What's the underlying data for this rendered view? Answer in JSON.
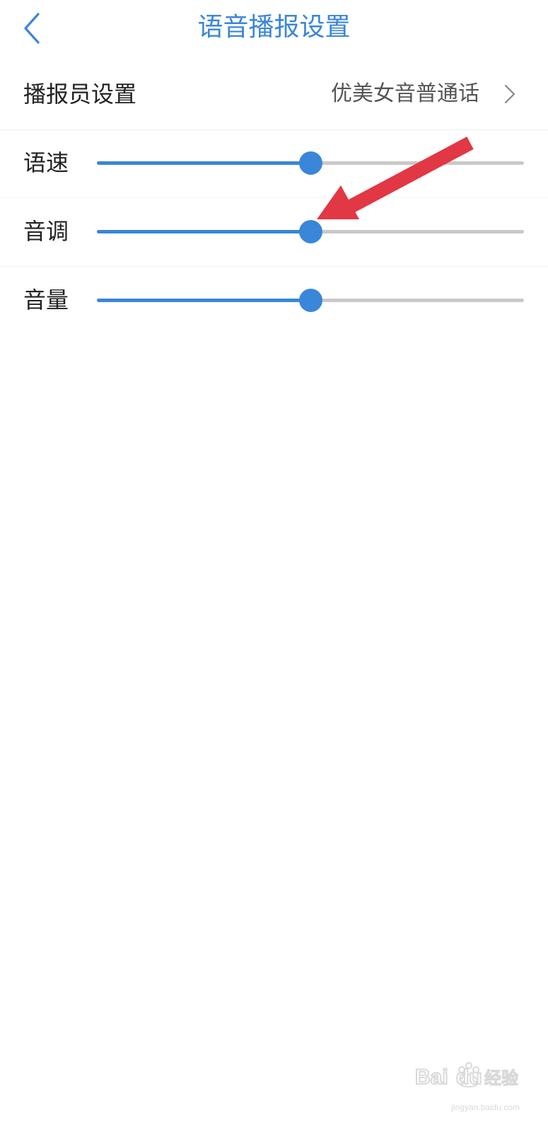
{
  "header": {
    "title": "语音播报设置",
    "back_icon": "chevron-left-icon"
  },
  "announcer": {
    "label": "播报员设置",
    "value": "优美女音普通话",
    "chevron_icon": "chevron-right-icon"
  },
  "sliders": [
    {
      "label": "语速",
      "level": 0.5
    },
    {
      "label": "音调",
      "level": 0.5
    },
    {
      "label": "音量",
      "level": 0.5
    }
  ],
  "annotation": {
    "type": "red-arrow",
    "points_to": "音调 slider thumb",
    "color": "#e23744"
  },
  "watermark": {
    "text": "Baidu经验",
    "url_text": "jingyan.baidu.com"
  },
  "colors": {
    "accent": "#3a86d8",
    "track": "#c9c9c9",
    "arrow": "#e23744"
  }
}
